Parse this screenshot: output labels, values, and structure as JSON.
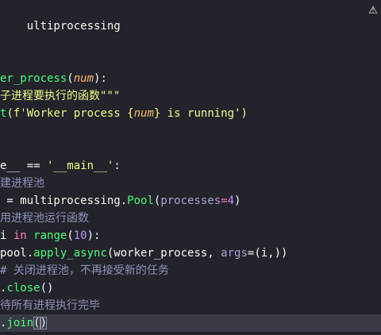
{
  "editor": {
    "line1": {
      "text": "ultiprocessing"
    },
    "line5": {
      "name": "er_process",
      "p1": "(",
      "param": "num",
      "p2": "):"
    },
    "line6": {
      "text": "子进程要执行的函数\"\"\""
    },
    "line7": {
      "fn": "t",
      "p1": "(f'",
      "s1": "Worker process {",
      "param": "num",
      "s2": "} is running",
      "p2": "')"
    },
    "line10": {
      "a": "e__ == ",
      "str": "'__main__'",
      "b": ":"
    },
    "line11": {
      "text": "建进程池"
    },
    "line12": {
      "a": " = multiprocessing.",
      "fn": "Pool",
      "p1": "(",
      "kwarg": "processes",
      "eq": "=",
      "num": "4",
      "p2": ")"
    },
    "line13": {
      "text": "用进程池运行函数"
    },
    "line14": {
      "a": "i ",
      "kw": "in",
      "sp": " ",
      "fn": "range",
      "p1": "(",
      "num": "10",
      "p2": "):"
    },
    "line15": {
      "a": "pool.",
      "fn": "apply_async",
      "p1": "(worker_process, ",
      "kwarg": "args",
      "p2": "=(i,))"
    },
    "line16": {
      "text": "# 关闭进程池，不再接受新的任务"
    },
    "line17": {
      "a": ".",
      "fn": "close",
      "p": "()"
    },
    "line18": {
      "text": "待所有进程执行完毕"
    },
    "line19": {
      "a": ".",
      "fn": "join",
      "p1": "(",
      "p2": ")"
    },
    "warning_icon": "warning-triangle"
  }
}
